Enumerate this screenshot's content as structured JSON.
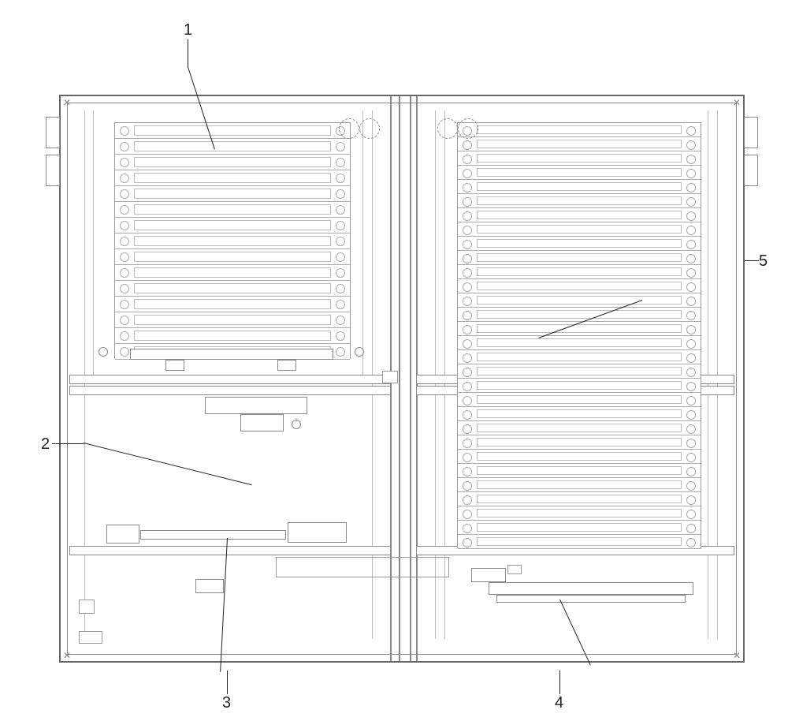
{
  "labels": {
    "callout_1": "1",
    "callout_2": "2",
    "callout_3": "3",
    "callout_4": "4",
    "callout_5": "5"
  },
  "slots": {
    "top_left_count": 15,
    "right_count": 30
  },
  "legend": {
    "type": "patent-figure",
    "description": "Mechanical cabinet assembly with tray storage stacks"
  }
}
